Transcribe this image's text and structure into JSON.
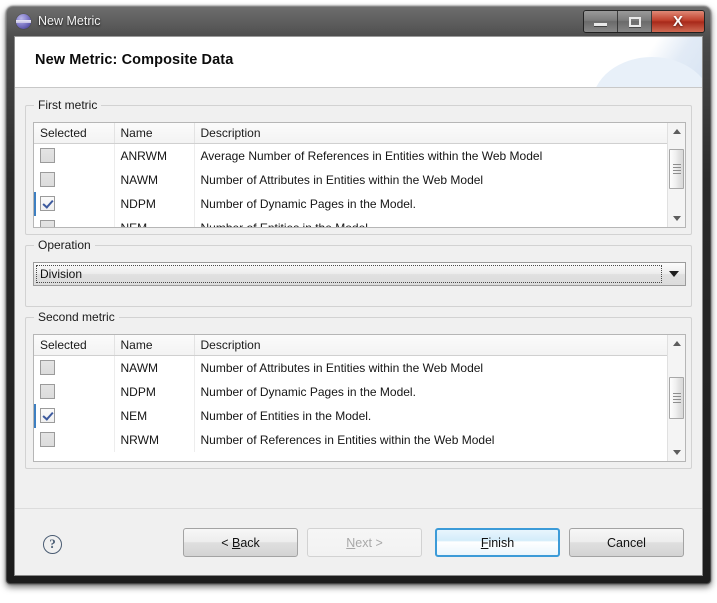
{
  "window": {
    "title": "New Metric",
    "icon": "eclipse-sphere-icon",
    "controls": {
      "minimize": "minimize-icon",
      "maximize": "maximize-icon",
      "close": "X"
    }
  },
  "banner": {
    "title": "New Metric: Composite Data"
  },
  "first_metric": {
    "group_label": "First metric",
    "columns": [
      "Selected",
      "Name",
      "Description"
    ],
    "rows": [
      {
        "selected": false,
        "name": "ANRWM",
        "description": "Average Number of References in Entities within the Web Model"
      },
      {
        "selected": false,
        "name": "NAWM",
        "description": "Number of Attributes in Entities within the Web Model"
      },
      {
        "selected": true,
        "name": "NDPM",
        "description": "Number of Dynamic Pages in the Model."
      },
      {
        "selected": false,
        "name": "NEM",
        "description": "Number of Entities in the Model."
      }
    ]
  },
  "operation": {
    "group_label": "Operation",
    "selected": "Division",
    "options": [
      "Division"
    ]
  },
  "second_metric": {
    "group_label": "Second metric",
    "columns": [
      "Selected",
      "Name",
      "Description"
    ],
    "rows": [
      {
        "selected": false,
        "name": "NAWM",
        "description": "Number of Attributes in Entities within the Web Model"
      },
      {
        "selected": false,
        "name": "NDPM",
        "description": "Number of Dynamic Pages in the Model."
      },
      {
        "selected": true,
        "name": "NEM",
        "description": "Number of Entities in the Model."
      },
      {
        "selected": false,
        "name": "NRWM",
        "description": "Number of References in Entities within the Web Model"
      }
    ]
  },
  "buttons": {
    "help": "?",
    "back_prefix": "< ",
    "back_key": "B",
    "back_rest": "ack",
    "next_key": "N",
    "next_rest": "ext",
    "next_suffix": " >",
    "finish_key": "F",
    "finish_rest": "inish",
    "cancel": "Cancel"
  },
  "colors": {
    "accent": "#3c9bd8",
    "checkmark": "#3d5a9e",
    "close_button": "#c0402c",
    "dialog_bg": "#f0f0f0"
  }
}
